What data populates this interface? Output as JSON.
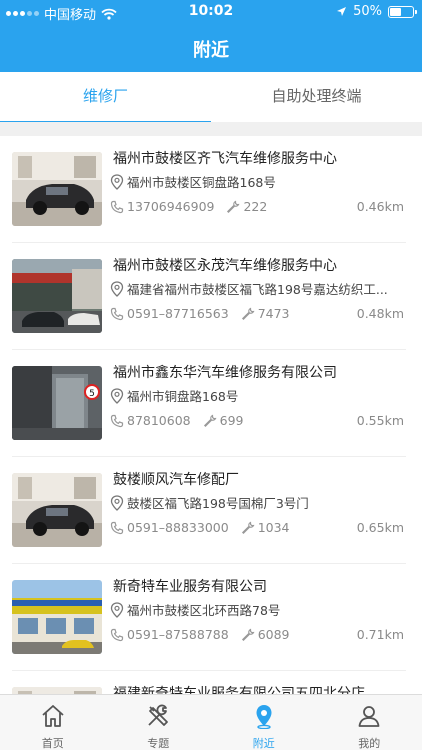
{
  "status_bar": {
    "carrier": "中国移动",
    "time": "10:02",
    "battery": "50%",
    "battery_level": 0.5
  },
  "header": {
    "title": "附近"
  },
  "tabs": [
    {
      "label": "维修厂",
      "active": true
    },
    {
      "label": "自助处理终端",
      "active": false
    }
  ],
  "shops": [
    {
      "name": "福州市鼓楼区齐飞汽车维修服务中心",
      "address": "福州市鼓楼区铜盘路168号",
      "phone": "13706946909",
      "count": "222",
      "distance": "0.46km"
    },
    {
      "name": "福州市鼓楼区永茂汽车维修服务中心",
      "address": "福建省福州市鼓楼区福飞路198号嘉达纺织工...",
      "phone": "0591–87716563",
      "count": "7473",
      "distance": "0.48km"
    },
    {
      "name": "福州市鑫东华汽车维修服务有限公司",
      "address": "福州市铜盘路168号",
      "phone": "87810608",
      "count": "699",
      "distance": "0.55km"
    },
    {
      "name": "鼓楼顺风汽车修配厂",
      "address": "鼓楼区福飞路198号国棉厂3号门",
      "phone": "0591–88833000",
      "count": "1034",
      "distance": "0.65km"
    },
    {
      "name": "新奇特车业服务有限公司",
      "address": "福州市鼓楼区北环西路78号",
      "phone": "0591–87588788",
      "count": "6089",
      "distance": "0.71km"
    },
    {
      "name": "福建新奇特车业服务有限公司五四北分店",
      "address": "",
      "phone": "",
      "count": "",
      "distance": ""
    }
  ],
  "tabbar": [
    {
      "label": "首页",
      "icon": "home-icon",
      "active": false
    },
    {
      "label": "专题",
      "icon": "tools-icon",
      "active": false
    },
    {
      "label": "附近",
      "icon": "location-pin-icon",
      "active": true
    },
    {
      "label": "我的",
      "icon": "user-icon",
      "active": false
    }
  ],
  "colors": {
    "primary": "#2aa3ee",
    "separator": "#f0f0f0"
  }
}
